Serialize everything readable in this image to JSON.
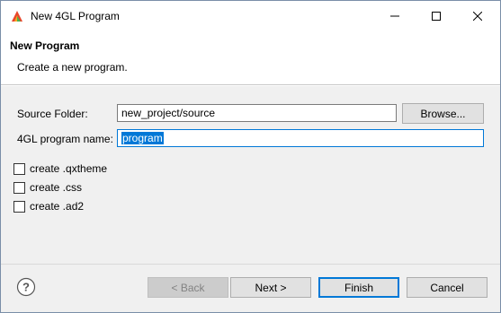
{
  "window": {
    "title": "New 4GL Program",
    "icon": "app-logo-icon"
  },
  "header": {
    "title": "New Program",
    "description": "Create a new program."
  },
  "form": {
    "source_folder_label": "Source Folder:",
    "source_folder_value": "new_project/source",
    "browse_label": "Browse...",
    "program_name_label": "4GL program name:",
    "program_name_value": "program",
    "options": [
      {
        "label": "create .qxtheme",
        "checked": false
      },
      {
        "label": "create .css",
        "checked": false
      },
      {
        "label": "create .ad2",
        "checked": false
      }
    ]
  },
  "footer": {
    "back_label": "< Back",
    "next_label": "Next >",
    "finish_label": "Finish",
    "cancel_label": "Cancel"
  },
  "colors": {
    "accent": "#0078d7",
    "content_bg": "#f0f0f0"
  }
}
